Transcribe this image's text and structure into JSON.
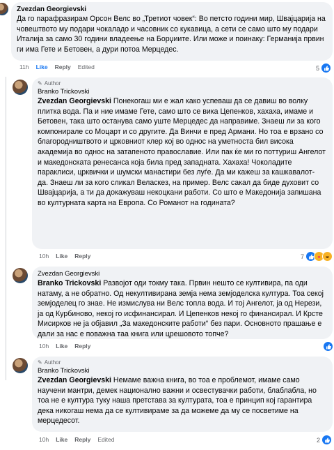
{
  "comments": [
    {
      "author": "Zvezdan Georgievski",
      "text": "Да го парафразирам Орсон Велс во „Третиот човек“: Во петсто години мир, Швајцарија на човештвото му подари чокаладо и часовник со кукавица, а сети се само што му подари Италија за само 30 години владеење на Борџиите. Или може и поинаку: Германија првин ги има Гете и Бетовен, а дури потоа Мерцедес.",
      "time": "11h",
      "like": "Like",
      "reply": "Reply",
      "edited": "Edited",
      "reactions": "5"
    },
    {
      "badge": "Author",
      "author": "Branko Trickovski",
      "mention": "Zvezdan Georgievski",
      "text": " Понекогаш ми е жал како успеваш да се давиш во волку плитка вода. Па и ние имаме Гете, само што се вика Цепенков, хахаха, имаме и Бетовен, така што останува само уште Мерцедес да направиме. Знаеш ли за кого компонирале со Моцарт и со другите. Да Винчи е пред Армани. Но тоа е врзано со благородништвото и црковниот клер кој во однос на уметноста бил висока академија во однос на затапеното православие. Или пак ќе ми го поттуриш Ангелот и македонската ренесанса која била пред западната. Хахаха! Чоколадите параклиси, црквички и шумски манастири без луѓе. Да ми кажеш за кашкавалот- да. Знаеш ли за кого сликал Веласкез, на пример. Велс сакал да биде духовит со Швајцарија, а ти да докажуваш некоцкани работи. Со што е Македонија запишана во културната карта на Европа. Со Романот на годината?",
      "time": "10h",
      "like": "Like",
      "reply": "Reply",
      "reactions": "7"
    },
    {
      "author": "Zvezdan Georgievski",
      "mention": "Branko Trickovski",
      "text": " Развојот оди токму така. Првин нешто се култивира, па оди натаму, а не обратно. Од некултивирана земја нема земјоделска култура. Тоа секој земјоделец го знае. Не измислува ни Велс топла вода. И тој Ангелот, ја од Нерези, ја од Курбиново, некој го исфинансирал. И Цепенков некој го финансирал. И Крсте Мисирков не ја објавил „За македонските работи“ без пари. Основното прашање е дали за нас е поважна таа книга или црешовото топче?",
      "time": "10h",
      "like": "Like",
      "reply": "Reply",
      "reactions": ""
    },
    {
      "badge": "Author",
      "author": "Branko Trickovski",
      "mention": "Zvezdan Georgievski",
      "text": " Немаме важна книга, во тоа е проблемот, имаме само научени мантри, демек национално важни и освестувачки работи, блаблабла, но тоа не е култура туку наша претстава за културата, тоа е принцип кој гарантира дека никогаш нема да се култивираме за да можеме да му се посветиме на мерцедесот.",
      "time": "10h",
      "like": "Like",
      "reply": "Reply",
      "edited": "Edited",
      "reactions": "2"
    }
  ]
}
